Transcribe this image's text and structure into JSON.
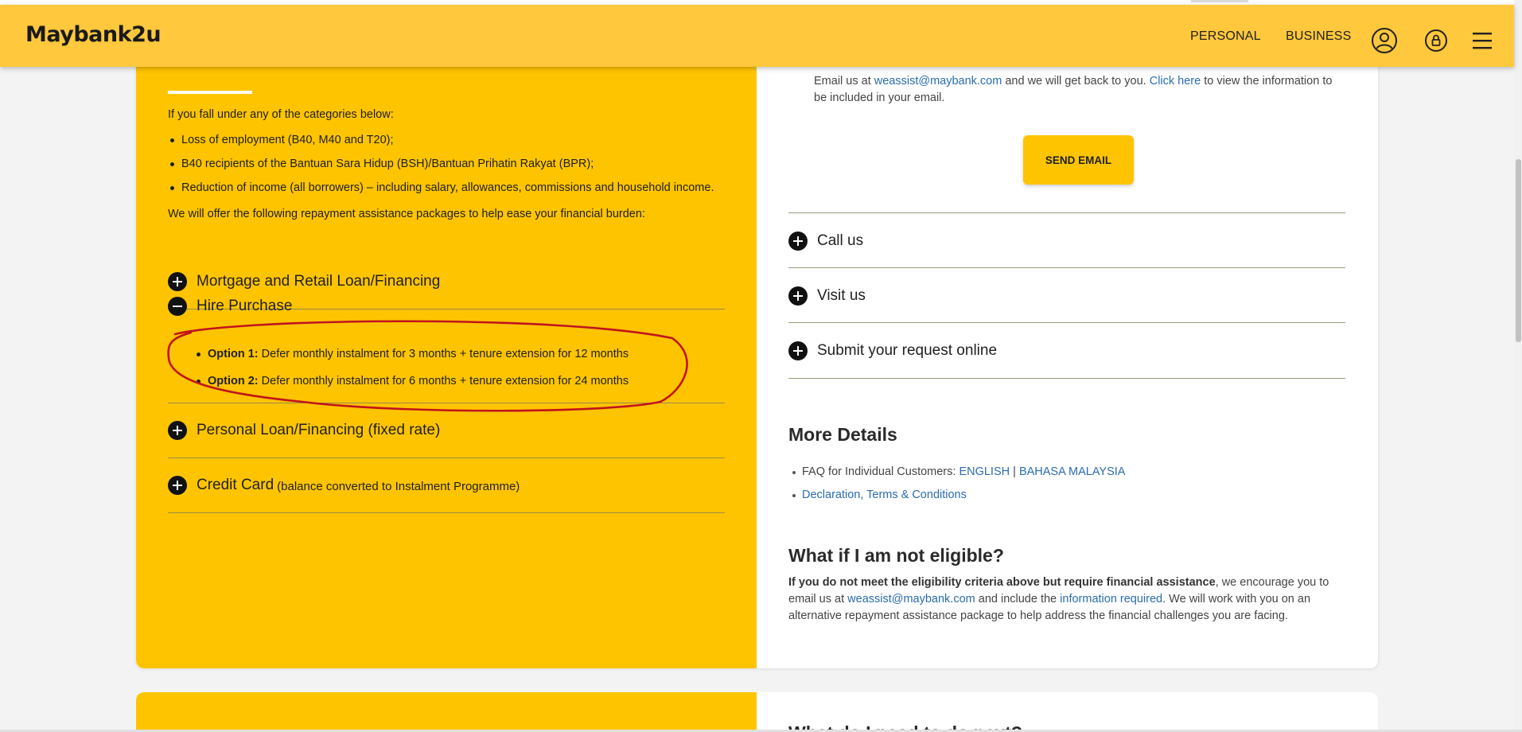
{
  "header": {
    "logo": "Maybank2u",
    "nav": {
      "personal": "PERSONAL",
      "business": "BUSINESS"
    },
    "icons": {
      "user": "user-circle-icon",
      "lock": "lock-icon",
      "menu": "hamburger-menu-icon"
    }
  },
  "left": {
    "intro": "If you fall under any of the categories below:",
    "categories": [
      "Loss of employment (B40, M40 and T20);",
      "B40 recipients of the Bantuan Sara Hidup (BSH)/Bantuan Prihatin Rakyat (BPR);",
      "Reduction of income (all borrowers) – including salary, allowances, commissions and household income."
    ],
    "offer": "We will offer the following repayment assistance packages to help ease your financial burden:",
    "accordion": {
      "mortgage": "Mortgage and Retail Loan/Financing",
      "hire_purchase": "Hire Purchase",
      "options": [
        {
          "label": "Option 1:",
          "text": " Defer monthly instalment for 3 months + tenure extension for 12 months"
        },
        {
          "label": "Option 2:",
          "text": " Defer monthly instalment for 6 months + tenure extension for 24 months"
        }
      ],
      "personal_loan": "Personal Loan/Financing (fixed rate)",
      "credit_card": "Credit Card",
      "credit_card_sub": "(balance converted to Instalment Programme)"
    }
  },
  "right": {
    "email": {
      "prefix": "Email us at ",
      "address": "weassist@maybank.com",
      "middle": " and we will get back to you. ",
      "click_here": "Click here",
      "suffix": " to view the information to be included in your email."
    },
    "send_email": "SEND EMAIL",
    "accordion": {
      "call": "Call us",
      "visit": "Visit us",
      "submit": "Submit your request online"
    },
    "more_details": {
      "heading": "More Details",
      "faq_prefix": "FAQ for Individual Customers: ",
      "faq_english": "ENGLISH",
      "faq_sep": " | ",
      "faq_bm": "BAHASA MALAYSIA",
      "declaration": "Declaration, Terms & Conditions"
    },
    "not_eligible": {
      "heading": "What if I am not eligible?",
      "bold": "If you do not meet the eligibility criteria above but require financial assistance",
      "text1": ", we encourage you to email us at ",
      "email": "weassist@maybank.com",
      "text2": " and include the ",
      "info_link": "information required",
      "text3": ". We will work with you on an alternative repayment assistance package to help address the financial challenges you are facing."
    }
  },
  "next_card": {
    "title": "What do I need to do next?"
  },
  "colors": {
    "brand_yellow": "#ffc400",
    "header_yellow": "#ffc83d",
    "link": "#2b6cb0",
    "annotation_red": "#c0141c"
  }
}
